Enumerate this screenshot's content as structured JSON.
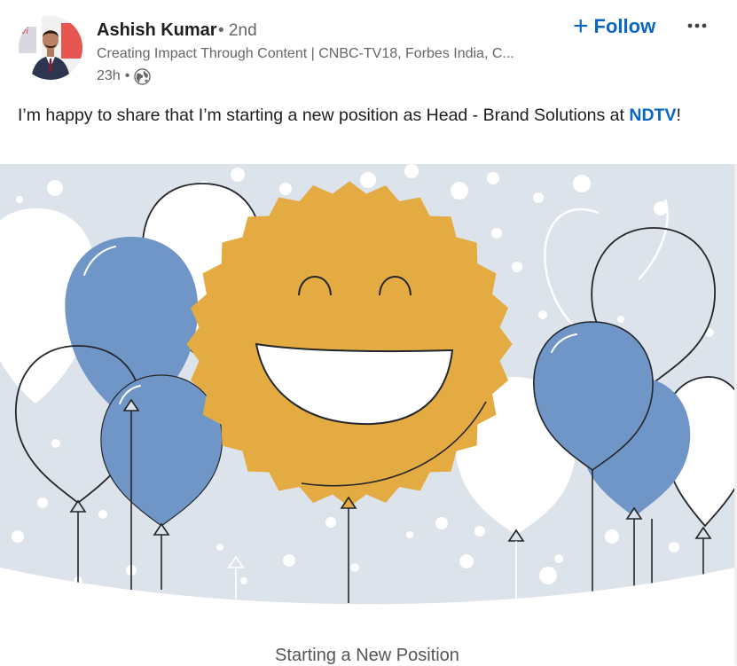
{
  "author": {
    "name": "Ashish Kumar",
    "degree": "• 2nd",
    "headline": "Creating Impact Through Content | CNBC-TV18, Forbes India, C...",
    "time": "23h",
    "visibility_icon": "globe-icon"
  },
  "actions": {
    "follow_label": "Follow",
    "follow_icon": "plus-icon",
    "more_icon": "more-horizontal-icon"
  },
  "post": {
    "text_before": "I’m happy to share that I’m starting a new position as Head - Brand Solutions at ",
    "company": "NDTV",
    "text_after": "!"
  },
  "banner": {
    "caption": "Starting a New Position"
  },
  "colors": {
    "accent": "#0a66c2",
    "balloon_blue": "#7096c7",
    "smiley_gold": "#e3ab41",
    "background": "#dde3ea"
  }
}
